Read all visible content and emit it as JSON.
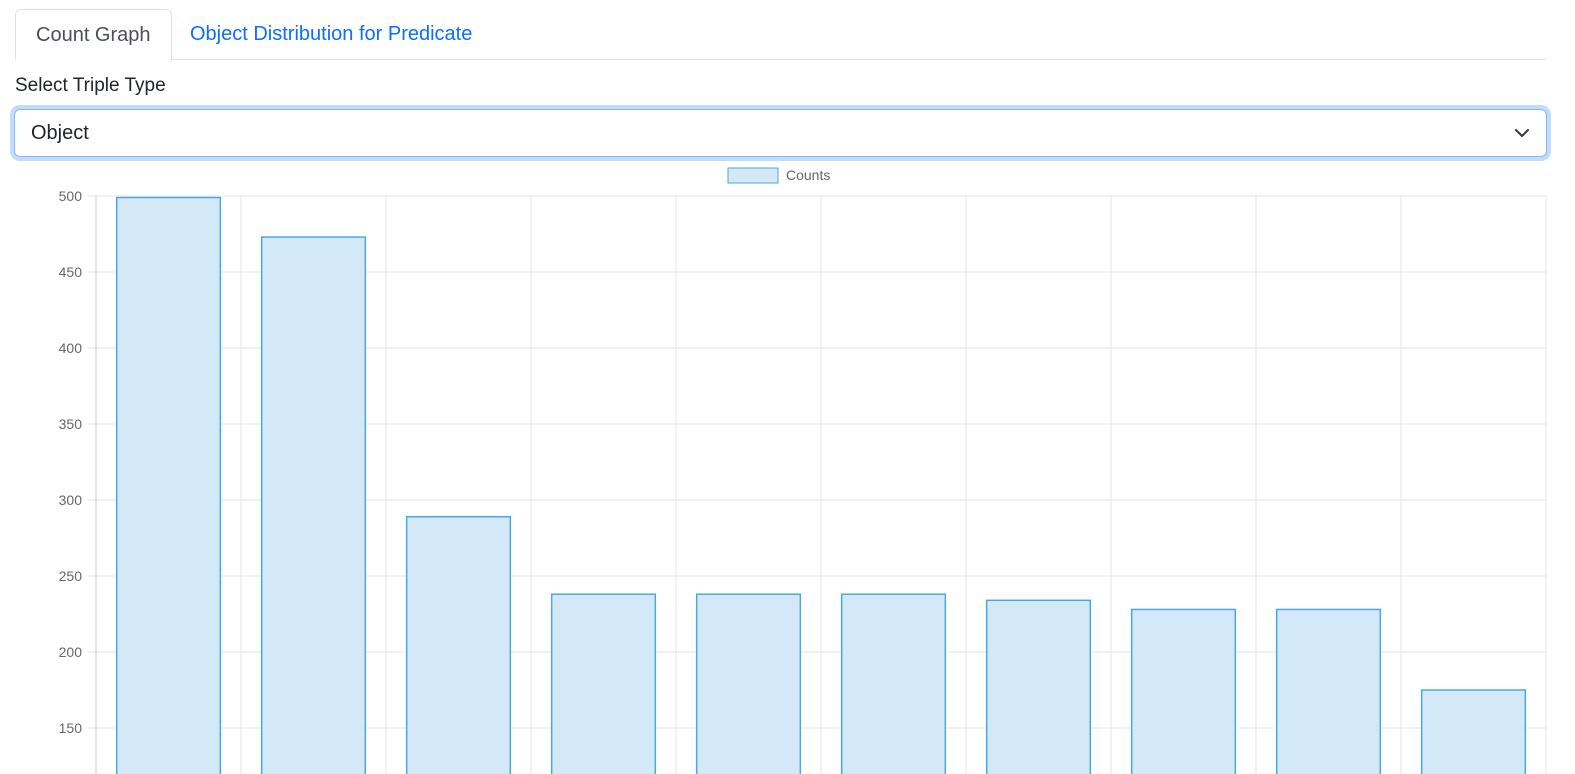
{
  "tabs": [
    {
      "label": "Count Graph",
      "active": true
    },
    {
      "label": "Object Distribution for Predicate",
      "active": false
    }
  ],
  "select": {
    "label": "Select Triple Type",
    "value": "Object"
  },
  "colors": {
    "bar_fill": "#d4e9f8",
    "bar_border": "#4aa8e0",
    "grid": "#e5e5e5",
    "tick_text": "#666666",
    "link": "#0d6efd",
    "focus_border": "#86b7fe"
  },
  "chart_data": {
    "type": "bar",
    "legend": [
      "Counts"
    ],
    "legend_position": "top",
    "series": [
      {
        "name": "Counts",
        "values": [
          499,
          473,
          289,
          238,
          238,
          238,
          234,
          228,
          228,
          175
        ]
      }
    ],
    "y_ticks": [
      "500",
      "450",
      "400",
      "350",
      "300",
      "250",
      "200",
      "150"
    ],
    "ylim": [
      150,
      500
    ],
    "grid": true
  }
}
